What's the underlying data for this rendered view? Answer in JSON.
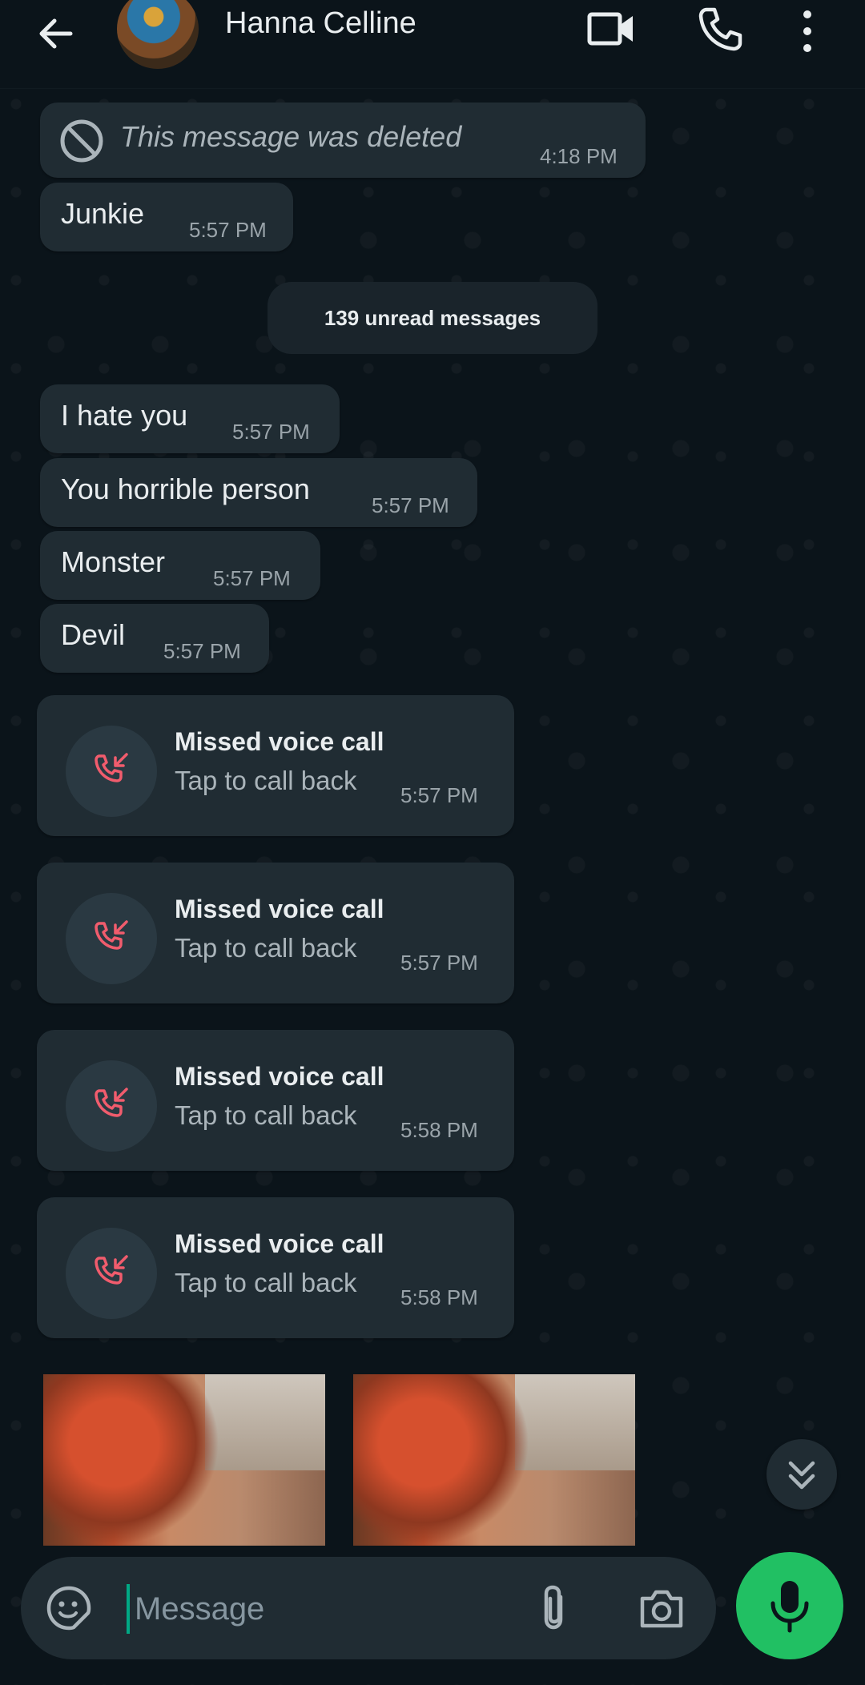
{
  "header": {
    "contact_name": "Hanna Celline",
    "icons": [
      "back-arrow-icon",
      "video-call-icon",
      "voice-call-icon",
      "more-vert-icon"
    ]
  },
  "messages": [
    {
      "type": "deleted",
      "text": "This message was deleted",
      "time": "4:18 PM"
    },
    {
      "type": "text",
      "text": "Junkie",
      "time": "5:57 PM"
    },
    {
      "type": "unread_divider",
      "text": "139 unread messages"
    },
    {
      "type": "text",
      "text": "I hate you",
      "time": "5:57 PM"
    },
    {
      "type": "text",
      "text": "You horrible person",
      "time": "5:57 PM"
    },
    {
      "type": "text",
      "text": "Monster",
      "time": "5:57 PM"
    },
    {
      "type": "text",
      "text": "Devil",
      "time": "5:57 PM"
    }
  ],
  "calls": [
    {
      "title": "Missed voice call",
      "subtitle": "Tap to call back",
      "time": "5:57 PM"
    },
    {
      "title": "Missed voice call",
      "subtitle": "Tap to call back",
      "time": "5:57 PM"
    },
    {
      "title": "Missed voice call",
      "subtitle": "Tap to call back",
      "time": "5:58 PM"
    },
    {
      "title": "Missed voice call",
      "subtitle": "Tap to call back",
      "time": "5:58 PM"
    }
  ],
  "composer": {
    "placeholder": "Message",
    "icons": [
      "sticker-icon",
      "attach-icon",
      "camera-icon",
      "mic-icon"
    ]
  },
  "colors": {
    "background": "#0b141a",
    "bubble": "#202c33",
    "accent": "#21c063",
    "missed_call_red": "#f15c6d"
  }
}
